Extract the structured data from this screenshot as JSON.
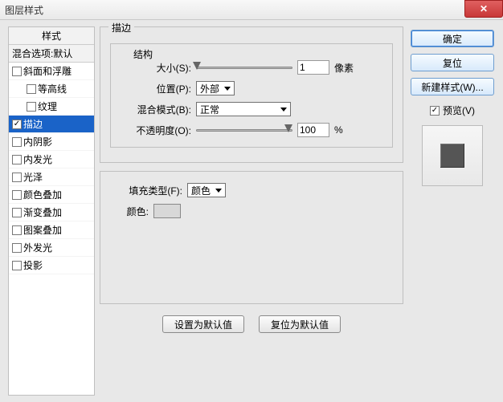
{
  "window": {
    "title": "图层样式"
  },
  "styles_panel": {
    "header": "样式",
    "blend_defaults": "混合选项:默认",
    "items": [
      {
        "label": "斜面和浮雕",
        "checked": false,
        "sub": false
      },
      {
        "label": "等高线",
        "checked": false,
        "sub": true
      },
      {
        "label": "纹理",
        "checked": false,
        "sub": true
      },
      {
        "label": "描边",
        "checked": true,
        "sub": false,
        "selected": true
      },
      {
        "label": "内阴影",
        "checked": false,
        "sub": false
      },
      {
        "label": "内发光",
        "checked": false,
        "sub": false
      },
      {
        "label": "光泽",
        "checked": false,
        "sub": false
      },
      {
        "label": "颜色叠加",
        "checked": false,
        "sub": false
      },
      {
        "label": "渐变叠加",
        "checked": false,
        "sub": false
      },
      {
        "label": "图案叠加",
        "checked": false,
        "sub": false
      },
      {
        "label": "外发光",
        "checked": false,
        "sub": false
      },
      {
        "label": "投影",
        "checked": false,
        "sub": false
      }
    ]
  },
  "stroke": {
    "group_label": "描边",
    "structure_label": "结构",
    "size_label": "大小(S):",
    "size_value": "1",
    "size_unit": "像素",
    "position_label": "位置(P):",
    "position_value": "外部",
    "blend_label": "混合模式(B):",
    "blend_value": "正常",
    "opacity_label": "不透明度(O):",
    "opacity_value": "100",
    "opacity_unit": "%",
    "fill_type_label": "填充类型(F):",
    "fill_type_value": "颜色",
    "color_label": "颜色:"
  },
  "buttons": {
    "make_default": "设置为默认值",
    "reset_default": "复位为默认值",
    "ok": "确定",
    "cancel": "复位",
    "new_style": "新建样式(W)...",
    "preview": "预览(V)"
  }
}
